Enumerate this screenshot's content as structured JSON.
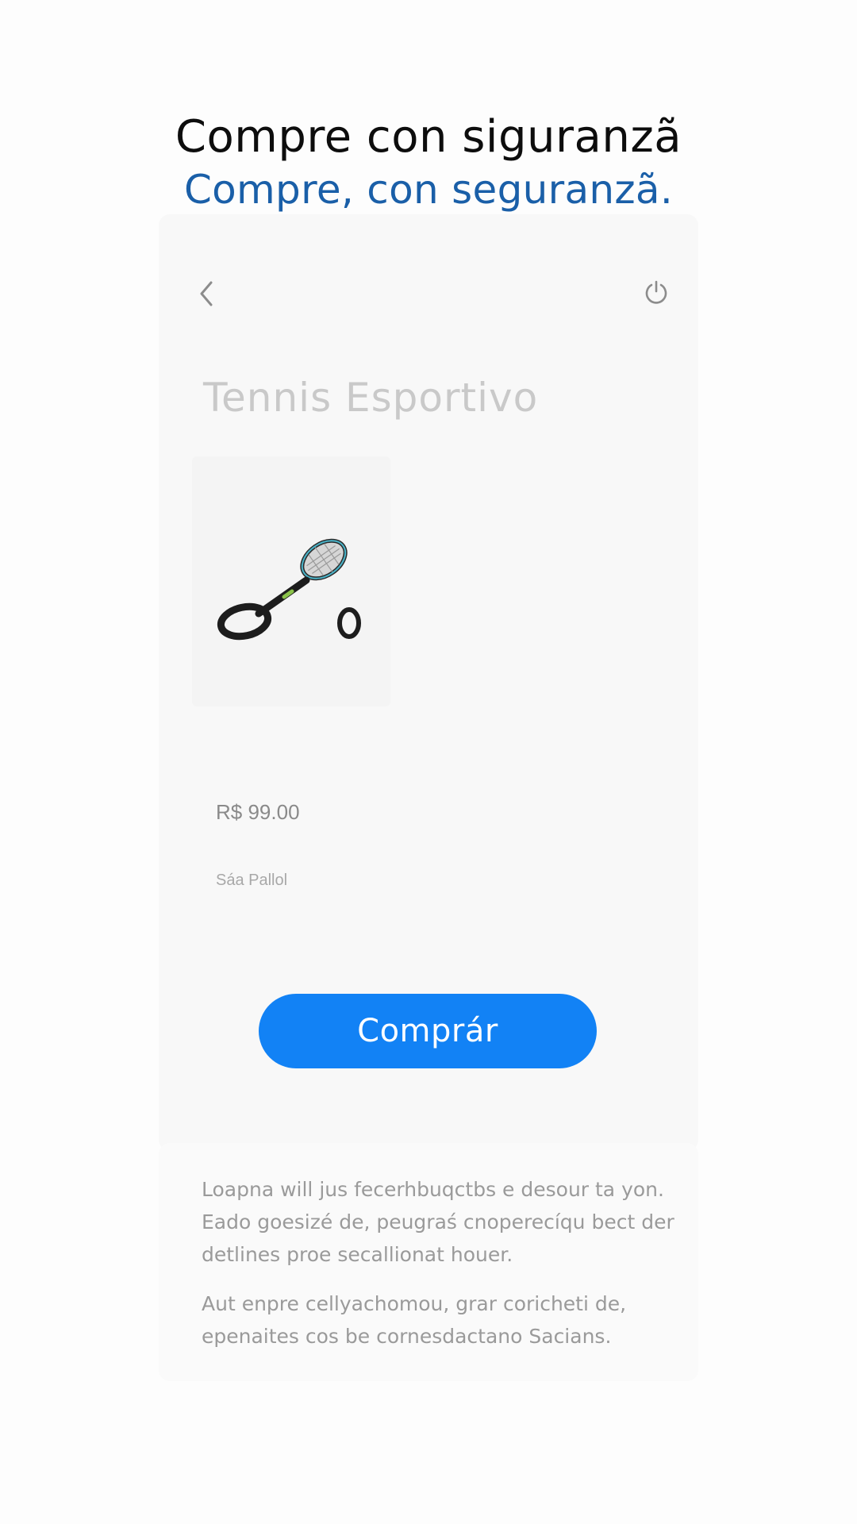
{
  "header": {
    "headline_primary": "Compre con siguranzã",
    "headline_secondary": "Compre, con seguranzã."
  },
  "toolbar": {
    "back_icon": "chevron-left-icon",
    "refresh_icon": "refresh-icon"
  },
  "product": {
    "title": "Tennis Esportivo",
    "image_icon": "tennis-racket-icon",
    "price": "R$ 99.00",
    "seller": "Sáa Pallol",
    "buy_label": "Comprár"
  },
  "description": {
    "paragraph_1": "Loapna will jus fecerhbuqctbs e desour ta yon. Eado goesizé de, peugraś cnoperecíqu bect der detlines proe secallionat houer.",
    "paragraph_2": "Aut enpre cellyachomou, grar coricheti de, epenaites cos be cornesdactano Sacians."
  },
  "colors": {
    "accent": "#1282f5",
    "headline_blue": "#1a5fa8"
  }
}
